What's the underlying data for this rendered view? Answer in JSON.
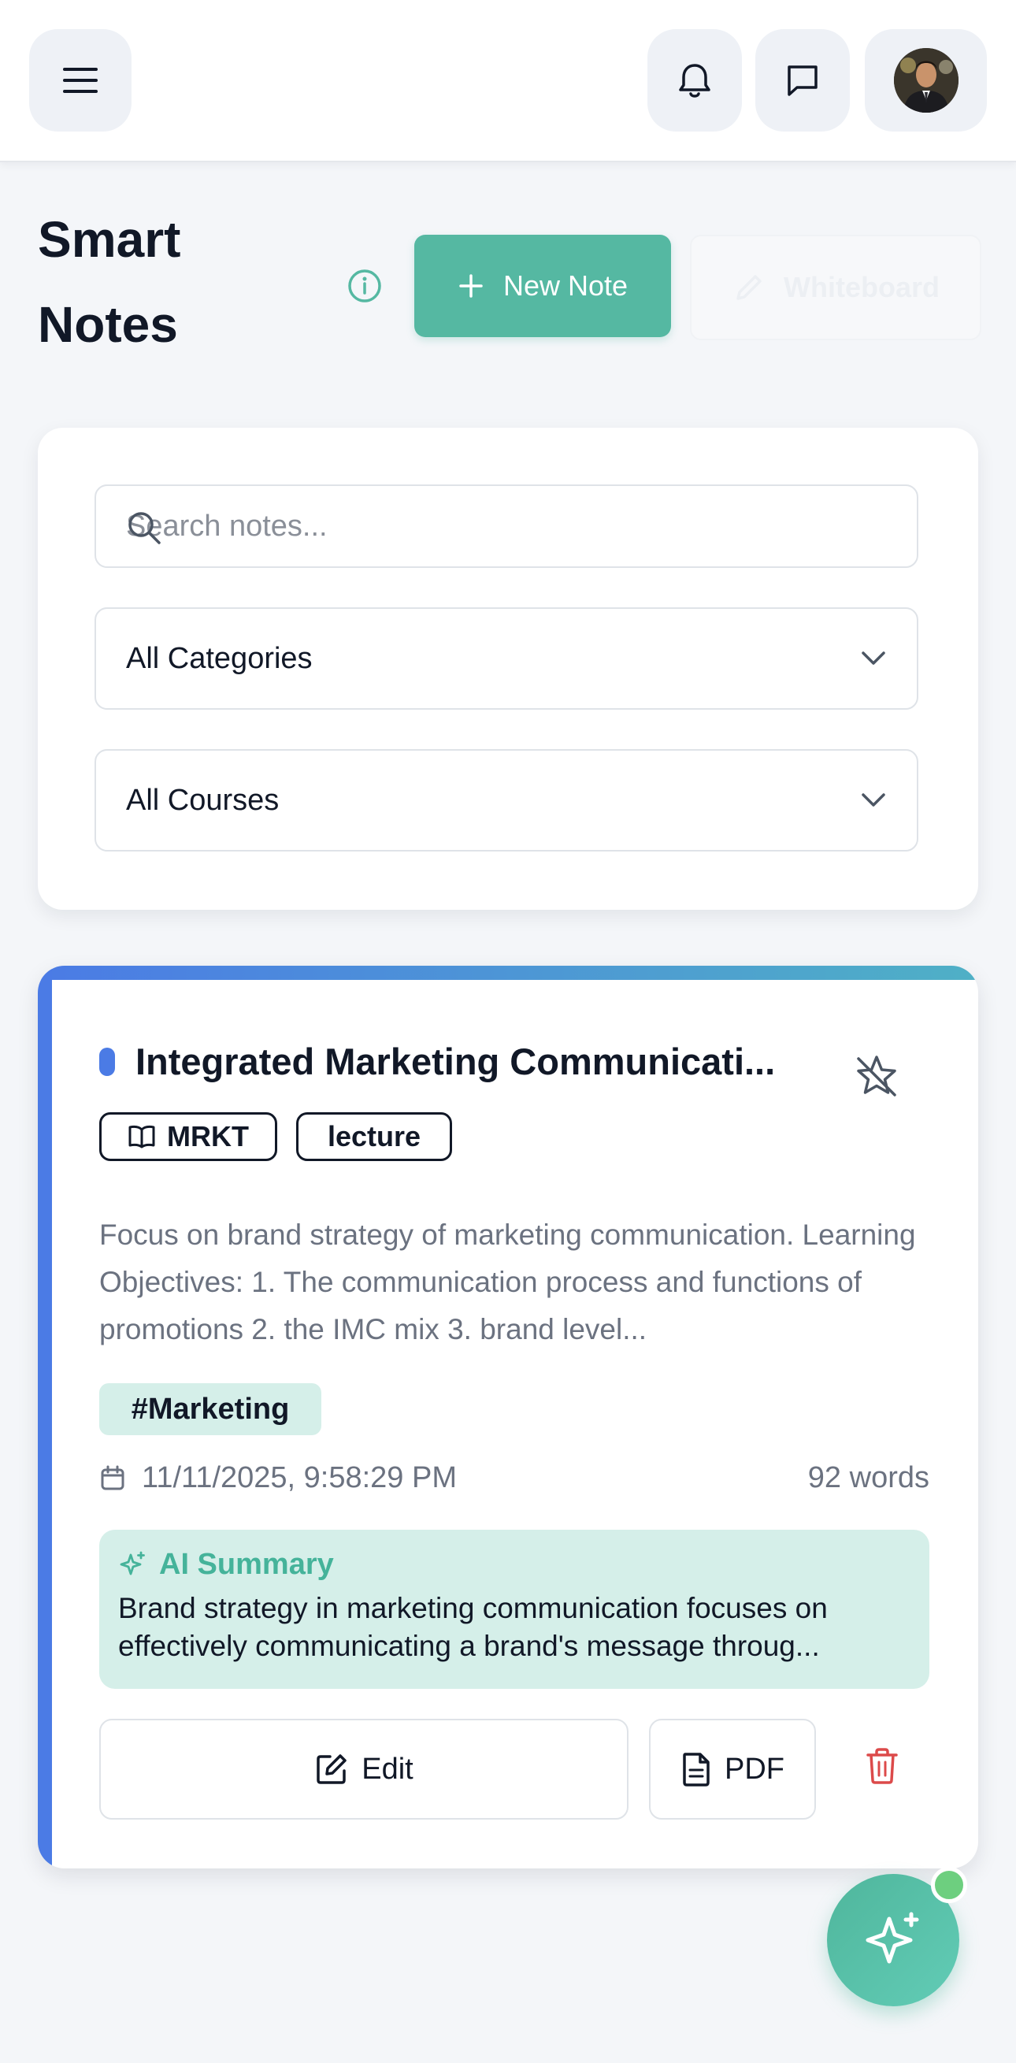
{
  "header": {
    "menu_icon": "hamburger-menu-icon",
    "notifications_icon": "bell-icon",
    "messages_icon": "chat-bubble-icon",
    "avatar": "user-avatar"
  },
  "page": {
    "title_line1": "Smart",
    "title_line2": "Notes",
    "info_icon": "info-circle-icon",
    "new_note_label": "New Note",
    "whiteboard_label": "Whiteboard"
  },
  "filters": {
    "search_placeholder": "Search notes...",
    "search_value": "",
    "category_selected": "All Categories",
    "course_selected": "All Courses"
  },
  "notes": [
    {
      "title": "Integrated Marketing Communicati...",
      "course": "MRKT",
      "type": "lecture",
      "body": "Focus on brand strategy of marketing communication. Learning Objectives: 1. The communication process and functions of promotions 2. the IMC mix 3. brand level...",
      "hashtag": "#Marketing",
      "timestamp": "11/11/2025, 9:58:29 PM",
      "word_count": "92 words",
      "ai_summary_label": "AI Summary",
      "ai_summary": "Brand strategy in marketing communication focuses on effectively communicating a brand's message throug...",
      "edit_label": "Edit",
      "pdf_label": "PDF",
      "starred": false
    }
  ],
  "colors": {
    "accent": "#55b8a2",
    "note_stripe": "#4b7be5",
    "ai_bg": "#d5efe9",
    "delete": "#dc4a4a",
    "online": "#6dcf7f"
  }
}
